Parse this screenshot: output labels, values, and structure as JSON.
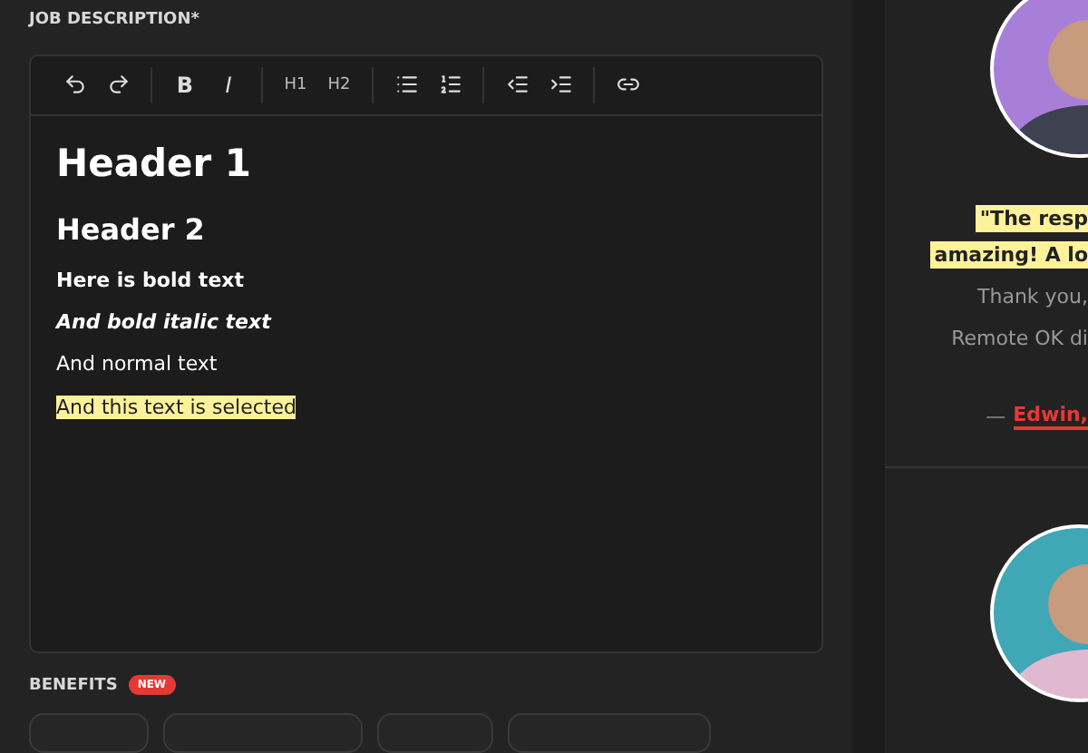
{
  "job_description": {
    "label": "JOB DESCRIPTION*",
    "toolbar": [
      [
        {
          "kind": "undo"
        },
        {
          "kind": "redo"
        }
      ],
      [
        {
          "kind": "bold",
          "label": "B"
        },
        {
          "kind": "italic",
          "label": "I"
        }
      ],
      [
        {
          "kind": "heading",
          "label": "H1"
        },
        {
          "kind": "heading",
          "label": "H2"
        }
      ],
      [
        {
          "kind": "bullets"
        },
        {
          "kind": "numbers"
        }
      ],
      [
        {
          "kind": "outdent"
        },
        {
          "kind": "indent"
        }
      ],
      [
        {
          "kind": "link"
        }
      ]
    ],
    "content": [
      {
        "kind": "h1",
        "text": "Header 1",
        "selected": false
      },
      {
        "kind": "h2",
        "text": "Header 2",
        "selected": false
      },
      {
        "kind": "bold",
        "text": "Here is bold text",
        "selected": false
      },
      {
        "kind": "bold-italic",
        "text": "And bold italic text",
        "selected": false
      },
      {
        "kind": "normal",
        "text": "And normal text",
        "selected": false
      },
      {
        "kind": "normal",
        "text": "And this text is selected",
        "selected": true
      }
    ]
  },
  "benefits": {
    "label": "BENEFITS",
    "badge": "NEW"
  },
  "testimonial": {
    "quote_lines": [
      {
        "text": "\"The resp",
        "highlight": true
      },
      {
        "text": "amazing! A lo",
        "highlight": true
      },
      {
        "text": "Thank you,",
        "highlight": false
      },
      {
        "text": "Remote OK di",
        "highlight": false
      }
    ],
    "dash": "—",
    "author": "Edwin,"
  }
}
